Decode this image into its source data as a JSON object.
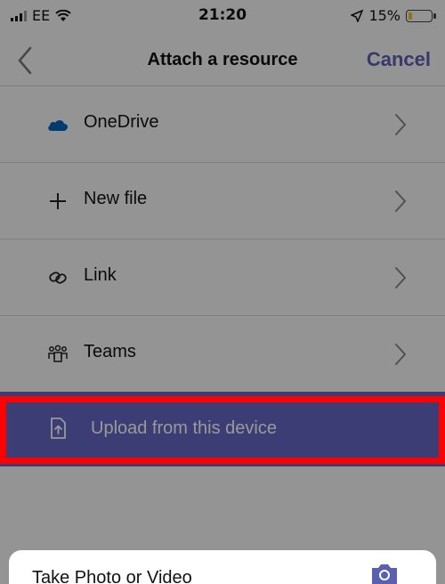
{
  "status_bar": {
    "carrier": "EE",
    "time": "21:20",
    "battery_text": "15%",
    "battery_level": 0.15
  },
  "nav": {
    "title": "Attach a resource",
    "cancel_label": "Cancel"
  },
  "list": {
    "items": [
      {
        "label": "OneDrive",
        "icon": "cloud-icon"
      },
      {
        "label": "New file",
        "icon": "plus-icon"
      },
      {
        "label": "Link",
        "icon": "link-icon"
      },
      {
        "label": "Teams",
        "icon": "teams-icon"
      }
    ]
  },
  "upload": {
    "label": "Upload from this device",
    "icon": "upload-file-icon"
  },
  "sheet": {
    "take_photo_label": "Take Photo or Video",
    "icon": "camera-icon"
  },
  "colors": {
    "accent": "#5a5fb1",
    "upload_bg": "#6367c2",
    "highlight": "#ff0000",
    "onedrive": "#0364b8"
  }
}
